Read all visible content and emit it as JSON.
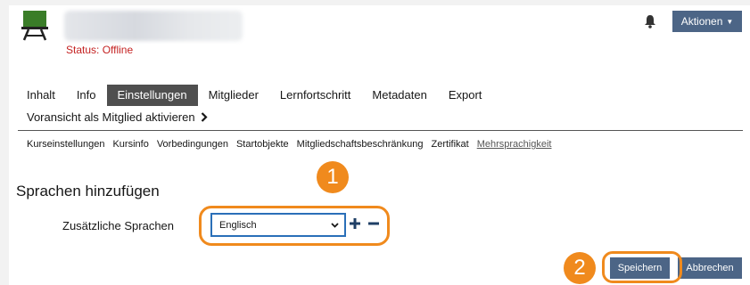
{
  "header": {
    "status": "Status: Offline",
    "actions_label": "Aktionen"
  },
  "tabs": [
    {
      "label": "Inhalt"
    },
    {
      "label": "Info"
    },
    {
      "label": "Einstellungen"
    },
    {
      "label": "Mitglieder"
    },
    {
      "label": "Lernfortschritt"
    },
    {
      "label": "Metadaten"
    },
    {
      "label": "Export"
    }
  ],
  "preview_link": "Voransicht als Mitglied aktivieren",
  "subtabs": [
    {
      "label": "Kurseinstellungen"
    },
    {
      "label": "Kursinfo"
    },
    {
      "label": "Vorbedingungen"
    },
    {
      "label": "Startobjekte"
    },
    {
      "label": "Mitgliedschaftsbeschränkung"
    },
    {
      "label": "Zertifikat"
    },
    {
      "label": "Mehrsprachigkeit"
    }
  ],
  "form": {
    "section_title": "Sprachen hinzufügen",
    "field_label": "Zusätzliche Sprachen",
    "selected_language": "Englisch"
  },
  "buttons": {
    "save": "Speichern",
    "cancel": "Abbrechen"
  },
  "annotations": {
    "step1": "1",
    "step2": "2",
    "accent": "#f08a1d"
  },
  "colors": {
    "primary_button": "#4c6586",
    "active_tab": "#4f4f4f",
    "status_offline": "#c42222"
  }
}
